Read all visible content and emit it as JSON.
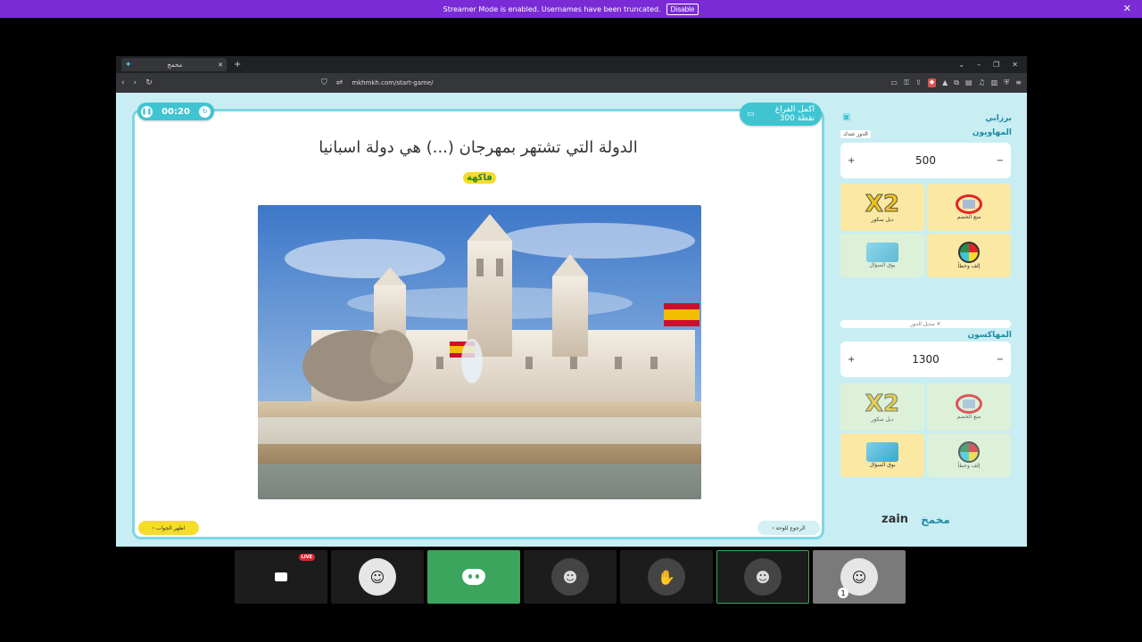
{
  "banner": {
    "text": "Streamer Mode is enabled. Usernames have been truncated.",
    "disable_label": "Disable",
    "close": "✕"
  },
  "browser": {
    "tab_title": "مخمخ",
    "tab_close": "✕",
    "new_tab": "+",
    "window_controls": [
      "⌄",
      "–",
      "❐",
      "✕"
    ],
    "url": "mkhmkh.com/start-game/",
    "nav": [
      "‹",
      "›",
      "↻"
    ]
  },
  "game": {
    "timer": "00:20",
    "category_title": "اكمل الفراغ",
    "category_points": "300 نقطة",
    "question": "الدولة التي تشتهر بمهرجان (...) هي دولة اسبانيا",
    "hint": "فاكهة",
    "show_answer": "اظهر الجواب",
    "back_to_board": "الرجوع للوحة"
  },
  "sidebar": {
    "app_name": "برزابي",
    "team1": {
      "name": "المهاويون",
      "turn_label": "الدور عندك",
      "score": "500",
      "plus": "+",
      "minus": "−"
    },
    "team2": {
      "name": "المهاكسون",
      "score": "1300",
      "plus": "+",
      "minus": "−"
    },
    "switch_turn": "✕ تبديل الدور",
    "tools": {
      "double": "دبل سكور",
      "block": "منع الخصم",
      "call": "بوق السؤال",
      "wheel": "إلف وخطأ"
    },
    "x2_art": "X2",
    "sponsors": {
      "zain": "zain",
      "logo2": "مخمخ"
    }
  },
  "participants": {
    "live": "LIVE",
    "count_badge": "1"
  }
}
